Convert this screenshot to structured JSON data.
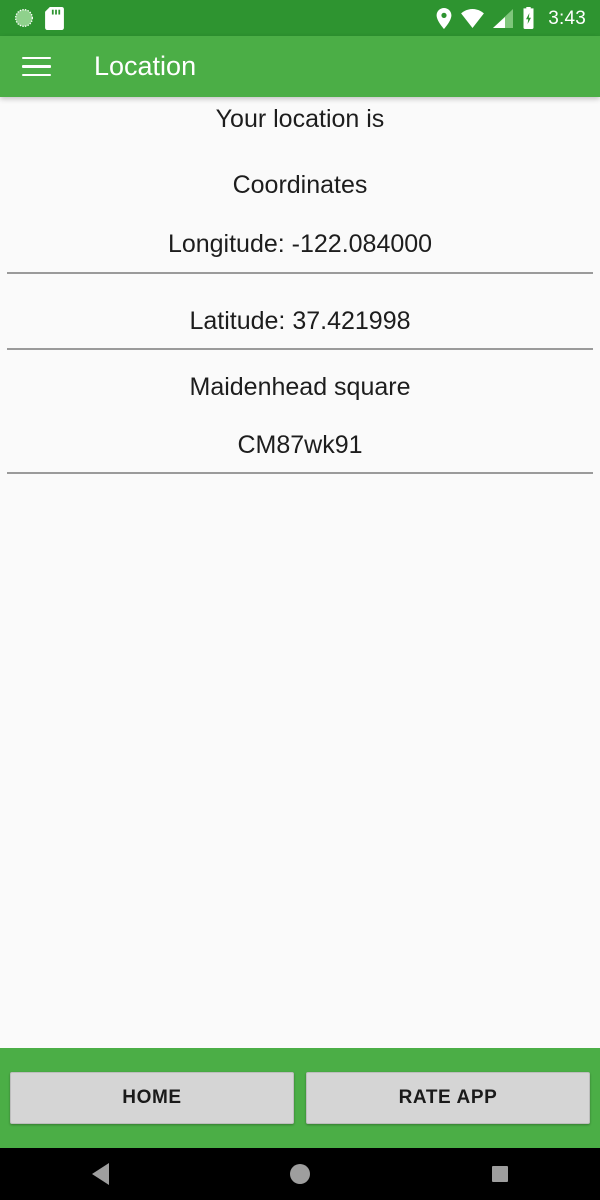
{
  "status_bar": {
    "icons_left": [
      "dnd-circle-icon",
      "sd-card-icon"
    ],
    "icons_right": [
      "location-pin-icon",
      "wifi-icon",
      "cell-signal-icon",
      "battery-charging-icon"
    ],
    "time": "3:43",
    "background_color": "#2E9430"
  },
  "app_bar": {
    "menu_icon": "hamburger-menu-icon",
    "title": "Location",
    "background_color": "#4BAE46"
  },
  "content": {
    "heading": "Your location is",
    "coordinates_label": "Coordinates",
    "longitude": "Longitude: -122.084000",
    "latitude": "Latitude: 37.421998",
    "maidenhead_label": "Maidenhead square",
    "maidenhead_value": "CM87wk91",
    "background_color": "#FAFAFA"
  },
  "action_bar": {
    "home_button": "HOME",
    "rate_button": "RATE APP",
    "background_color": "#4BAE46",
    "button_color": "#D5D5D5"
  },
  "nav_bar": {
    "back": "back-triangle-icon",
    "home": "home-circle-icon",
    "recents": "recents-square-icon",
    "background_color": "#000000"
  }
}
